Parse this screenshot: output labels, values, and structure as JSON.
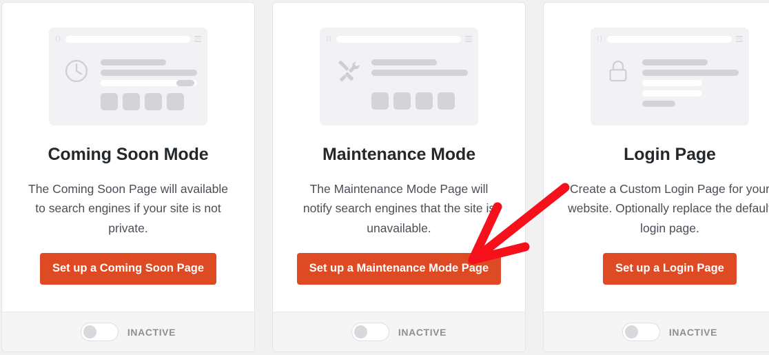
{
  "page": {
    "background_color": "#f1f1f2",
    "accent_color": "#dd4a24",
    "heading_color": "#23282d",
    "body_text_color": "#4a4f57"
  },
  "cards": [
    {
      "id": "coming-soon-mode",
      "icon": "clock-icon",
      "title": "Coming Soon Mode",
      "description": "The Coming Soon Page will available to search engines if your site is not private.",
      "button_label": "Set up a Coming Soon Page",
      "toggle": {
        "state": "off",
        "label": "INACTIVE"
      }
    },
    {
      "id": "maintenance-mode",
      "icon": "tools-icon",
      "title": "Maintenance Mode",
      "description": "The Maintenance Mode Page will notify search engines that the site is unavailable.",
      "button_label": "Set up a Maintenance Mode Page",
      "toggle": {
        "state": "off",
        "label": "INACTIVE"
      }
    },
    {
      "id": "login-page",
      "icon": "lock-icon",
      "title": "Login Page",
      "description": "Create a Custom Login Page for your website. Optionally replace the default login page.",
      "button_label": "Set up a Login Page",
      "toggle": {
        "state": "off",
        "label": "INACTIVE"
      }
    }
  ],
  "annotation": {
    "type": "arrow",
    "color": "#f5101b",
    "points_to": "maintenance-mode-cta-button"
  }
}
